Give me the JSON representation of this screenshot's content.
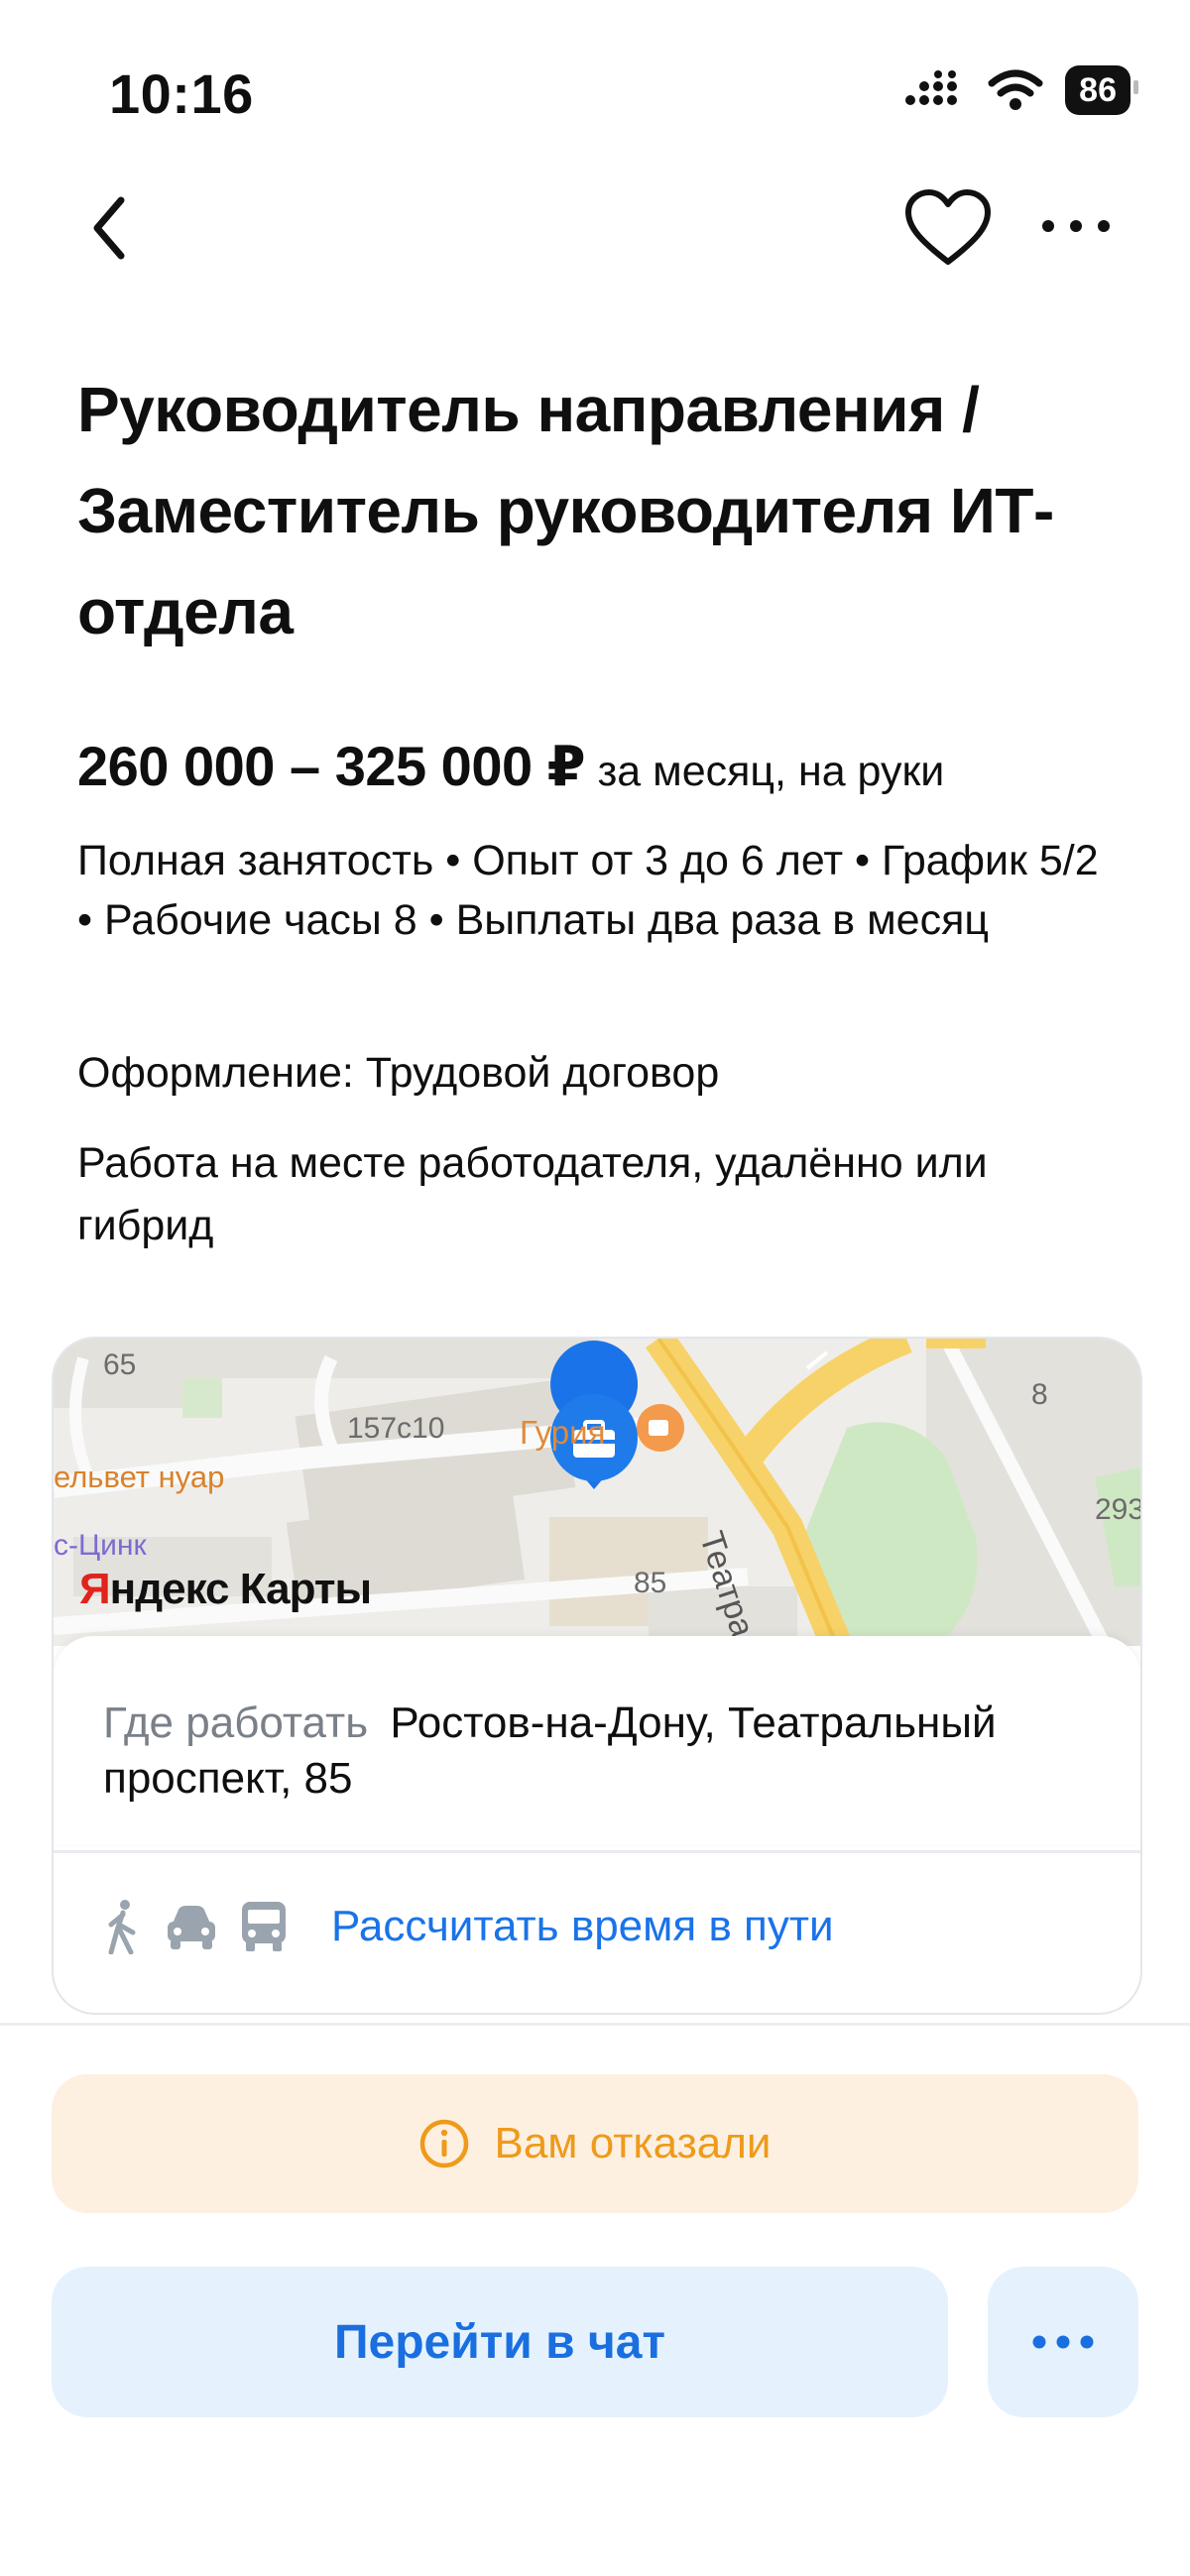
{
  "status_bar": {
    "time": "10:16",
    "battery": "86"
  },
  "vacancy": {
    "title": "Руководитель направления / Заместитель руководителя ИТ-отдела",
    "salary": "260 000 – 325 000 ₽",
    "salary_note": "за месяц, на руки",
    "details": "Полная занятость • Опыт от 3 до 6 лет • График 5/2 • Рабочие часы 8 • Выплаты два раза в месяц",
    "formalization": "Оформление: Трудовой договор",
    "workplace": "Работа на месте работодателя, удалённо или гибрид"
  },
  "map": {
    "labels": {
      "n65": "65",
      "n157": "157с10",
      "cafe": "Гурия",
      "nuar": "ельвет нуар",
      "zink": "с-Цинк",
      "n85": "85",
      "n8": "8",
      "n293": "293",
      "street": "Театральн"
    },
    "provider_ya": "Я",
    "provider_rest": "ндекс Карты",
    "address_label": "Где работать",
    "address": "Ростов-на-Дону, Театральный проспект, 85",
    "route_link": "Рассчитать время в пути"
  },
  "status_banner": {
    "text": "Вам отказали",
    "color": "#ef9a1a"
  },
  "actions": {
    "chat_button": "Перейти в чат"
  },
  "icons": [
    "back-icon",
    "heart-icon",
    "more-icon",
    "info-icon",
    "walk-icon",
    "car-icon",
    "bus-icon",
    "briefcase-pin-icon",
    "cafe-icon"
  ],
  "colors": {
    "link": "#1a73e8",
    "accent_orange": "#ef9a1a",
    "button_bg": "#e5f2fd",
    "brand_red": "#e0231c"
  }
}
